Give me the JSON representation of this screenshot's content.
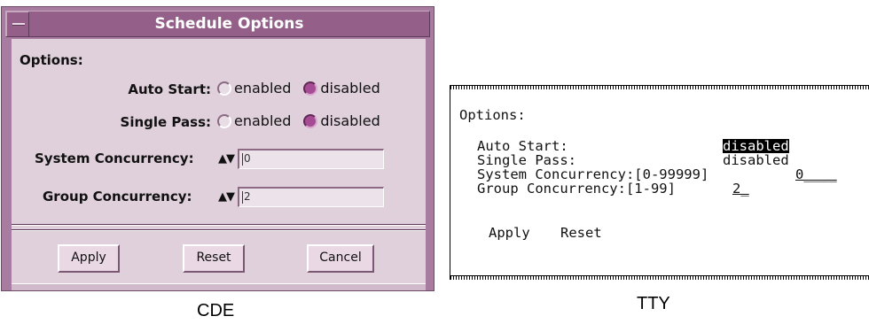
{
  "cde": {
    "window_title": "Schedule Options",
    "options_label": "Options:",
    "auto_start_label": "Auto Start:",
    "single_pass_label": "Single Pass:",
    "radio_enabled": "enabled",
    "radio_disabled": "disabled",
    "auto_start_value": "disabled",
    "single_pass_value": "disabled",
    "system_concurrency_label": "System Concurrency:",
    "system_concurrency_value": "0",
    "group_concurrency_label": "Group Concurrency:",
    "group_concurrency_value": "2",
    "spinner_arrows": "▲▼",
    "apply_label": "Apply",
    "reset_label": "Reset",
    "cancel_label": "Cancel",
    "colors": {
      "frame": "#a87ba0",
      "titlebar": "#946089",
      "body": "#e0d0dc",
      "radio_selected": "#a64c94"
    }
  },
  "tty": {
    "options_label": "Options:",
    "auto_start_label": "Auto Start:",
    "auto_start_value": "disabled",
    "single_pass_label": "Single Pass:",
    "single_pass_value": "disabled",
    "system_concurrency_label": "System Concurrency:[0-99999]",
    "system_concurrency_value": "0____",
    "group_concurrency_label": "Group Concurrency:[1-99]",
    "group_concurrency_value": "2_",
    "apply_label": "Apply",
    "reset_label": "Reset"
  },
  "captions": {
    "cde": "CDE",
    "tty": "TTY"
  }
}
